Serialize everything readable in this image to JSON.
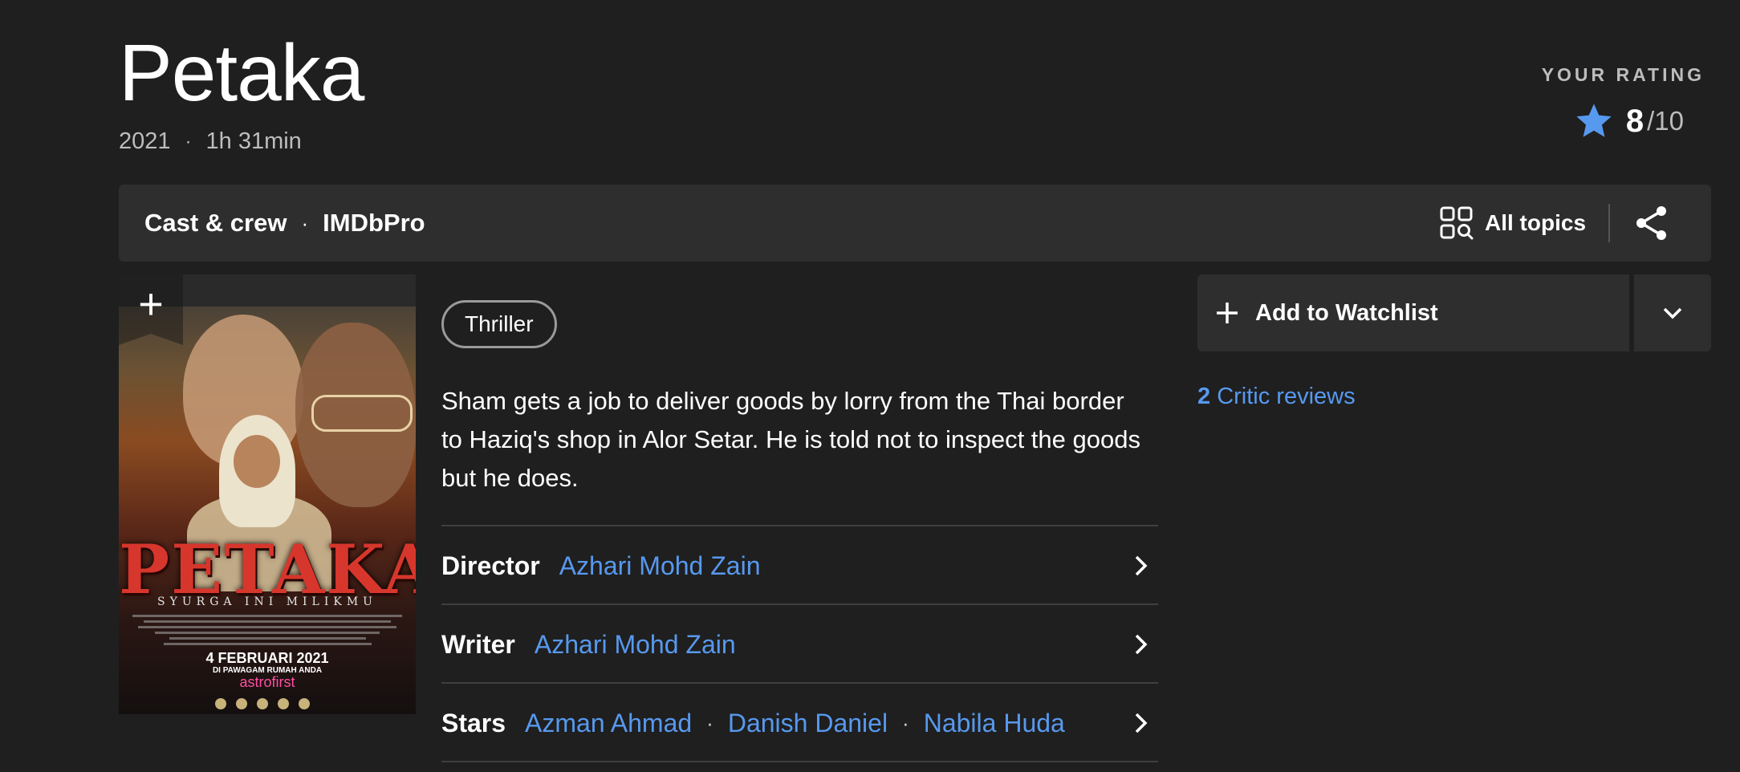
{
  "title": "Petaka",
  "meta": {
    "year": "2021",
    "separator": "·",
    "runtime": "1h 31min"
  },
  "rating": {
    "label": "YOUR RATING",
    "value": "8",
    "out_of": "/10",
    "star_color": "#5799ef"
  },
  "topbar": {
    "cast_crew": "Cast & crew",
    "separator": "·",
    "imdbpro": "IMDbPro",
    "all_topics": "All topics"
  },
  "poster": {
    "title": "PETAKA",
    "subtitle": "SYURGA INI MILIKMU",
    "release": "4 FEBRUARI 2021",
    "release_sub": "DI PAWAGAM RUMAH ANDA",
    "brand": "astrofirst"
  },
  "genre": "Thriller",
  "plot": "Sham gets a job to deliver goods by lorry from the Thai border to Haziq's shop in Alor Setar. He is told not to inspect the goods but he does.",
  "credits": {
    "director": {
      "label": "Director",
      "names": [
        "Azhari Mohd Zain"
      ]
    },
    "writer": {
      "label": "Writer",
      "names": [
        "Azhari Mohd Zain"
      ]
    },
    "stars": {
      "label": "Stars",
      "names": [
        "Azman Ahmad",
        "Danish Daniel",
        "Nabila Huda"
      ],
      "separator": "·"
    }
  },
  "watchlist": {
    "label": "Add to Watchlist"
  },
  "critic_reviews": {
    "count": "2",
    "label": "Critic reviews"
  },
  "colors": {
    "background": "#1f1f1f",
    "panel": "#2e2e2e",
    "link": "#5799ef"
  }
}
